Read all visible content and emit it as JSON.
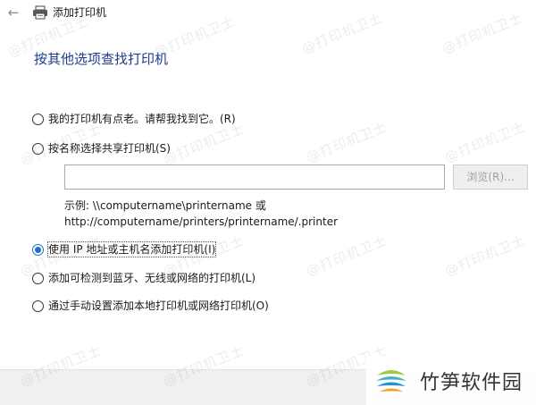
{
  "window": {
    "title": "添加打印机",
    "back_icon": "←"
  },
  "heading": "按其他选项查找打印机",
  "options": [
    {
      "label": "我的打印机有点老。请帮我找到它。(R)",
      "checked": false
    },
    {
      "label": "按名称选择共享打印机(S)",
      "checked": false
    },
    {
      "label": "使用 IP 地址或主机名添加打印机(I)",
      "checked": true
    },
    {
      "label": "添加可检测到蓝牙、无线或网络的打印机(L)",
      "checked": false
    },
    {
      "label": "通过手动设置添加本地打印机或网络打印机(O)",
      "checked": false
    }
  ],
  "share": {
    "value": "",
    "placeholder": "",
    "browse_label": "浏览(R)...",
    "example_line1": "示例: \\\\computername\\printername 或",
    "example_line2": "http://computername/printers/printername/.printer"
  },
  "watermark": "@打印机卫士",
  "brand": {
    "name": "竹笋软件园"
  },
  "colors": {
    "heading": "#1f3b8c",
    "radio_accent": "#1a73c9",
    "bottom_bar": "#f0f0f0"
  }
}
